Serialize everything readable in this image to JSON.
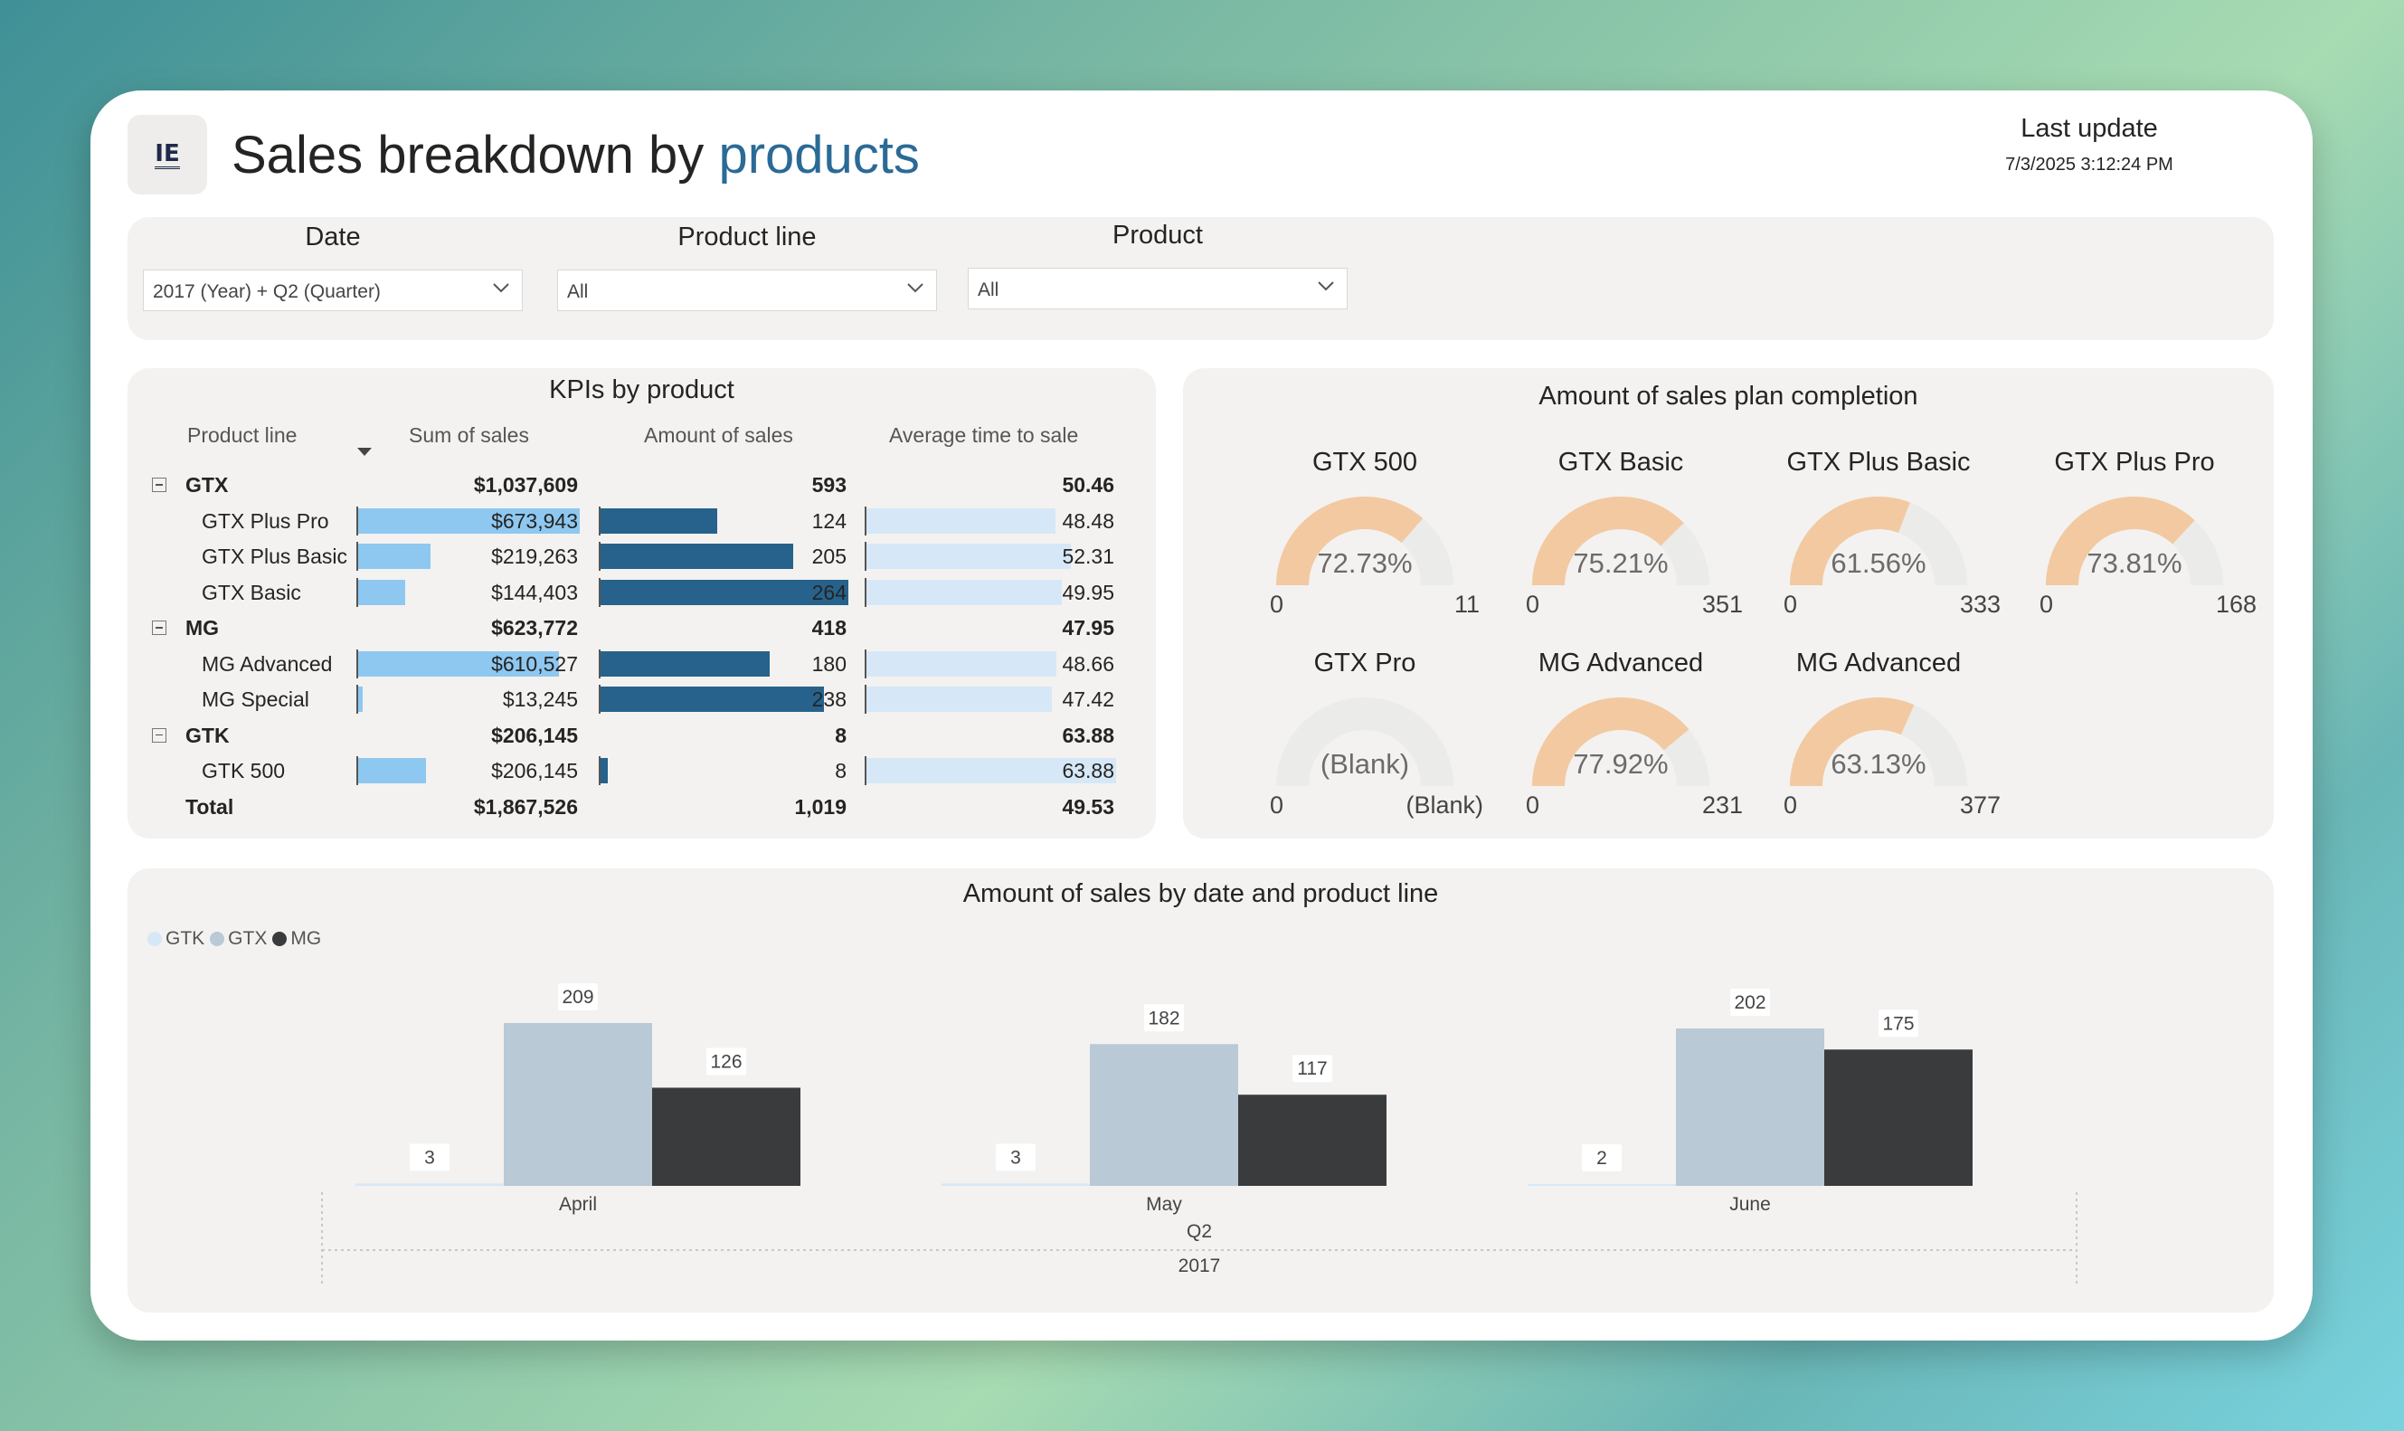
{
  "header": {
    "logo": "IE",
    "title_part1": "Sales breakdown by ",
    "title_part2": "products",
    "last_update_label": "Last update",
    "last_update_value": "7/3/2025 3:12:24 PM"
  },
  "filters": {
    "date": {
      "label": "Date",
      "value": "2017 (Year) + Q2 (Quarter)"
    },
    "product_line": {
      "label": "Product line",
      "value": "All"
    },
    "product": {
      "label": "Product",
      "value": "All"
    }
  },
  "kpi_table": {
    "title": "KPIs by product",
    "headers": [
      "Product line",
      "Sum of sales",
      "Amount of sales",
      "Average time to sale"
    ],
    "rows": [
      {
        "label": "GTX",
        "level": "group",
        "sum": "$1,037,609",
        "amount": "593",
        "avg": "50.46"
      },
      {
        "label": "GTX Plus Pro",
        "level": "item",
        "sum": "$673,943",
        "amount": "124",
        "avg": "48.48",
        "sum_v": 673943,
        "amt_v": 124,
        "avg_v": 48.48
      },
      {
        "label": "GTX Plus Basic",
        "level": "item",
        "sum": "$219,263",
        "amount": "205",
        "avg": "52.31",
        "sum_v": 219263,
        "amt_v": 205,
        "avg_v": 52.31
      },
      {
        "label": "GTX Basic",
        "level": "item",
        "sum": "$144,403",
        "amount": "264",
        "avg": "49.95",
        "sum_v": 144403,
        "amt_v": 264,
        "avg_v": 49.95
      },
      {
        "label": "MG",
        "level": "group",
        "sum": "$623,772",
        "amount": "418",
        "avg": "47.95"
      },
      {
        "label": "MG Advanced",
        "level": "item",
        "sum": "$610,527",
        "amount": "180",
        "avg": "48.66",
        "sum_v": 610527,
        "amt_v": 180,
        "avg_v": 48.66
      },
      {
        "label": "MG Special",
        "level": "item",
        "sum": "$13,245",
        "amount": "238",
        "avg": "47.42",
        "sum_v": 13245,
        "amt_v": 238,
        "avg_v": 47.42
      },
      {
        "label": "GTK",
        "level": "group",
        "sum": "$206,145",
        "amount": "8",
        "avg": "63.88"
      },
      {
        "label": "GTK 500",
        "level": "item",
        "sum": "$206,145",
        "amount": "8",
        "avg": "63.88",
        "sum_v": 206145,
        "amt_v": 8,
        "avg_v": 63.88
      },
      {
        "label": "Total",
        "level": "total",
        "sum": "$1,867,526",
        "amount": "1,019",
        "avg": "49.53"
      }
    ],
    "colors": {
      "sum_bar": "#8ec8f0",
      "amount_bar": "#26628c",
      "avg_bar": "#d6e8f7"
    }
  },
  "gauges": {
    "title": "Amount of sales plan completion",
    "items": [
      {
        "name": "GTX 500",
        "pct": "72.73%",
        "value": 0.7273,
        "min": "0",
        "max": "11"
      },
      {
        "name": "GTX Basic",
        "pct": "75.21%",
        "value": 0.7521,
        "min": "0",
        "max": "351"
      },
      {
        "name": "GTX Plus Basic",
        "pct": "61.56%",
        "value": 0.6156,
        "min": "0",
        "max": "333"
      },
      {
        "name": "GTX Plus Pro",
        "pct": "73.81%",
        "value": 0.7381,
        "min": "0",
        "max": "168"
      },
      {
        "name": "GTX Pro",
        "pct": "(Blank)",
        "value": 0,
        "min": "0",
        "max": "(Blank)"
      },
      {
        "name": "MG Advanced",
        "pct": "77.92%",
        "value": 0.7792,
        "min": "0",
        "max": "231"
      },
      {
        "name": "MG Advanced",
        "pct": "63.13%",
        "value": 0.6313,
        "min": "0",
        "max": "377"
      }
    ],
    "colors": {
      "fill": "#f2c9a1",
      "track": "#ebebea"
    }
  },
  "chart_data": {
    "type": "bar",
    "title": "Amount of sales by date and product line",
    "categories": [
      "April",
      "May",
      "June"
    ],
    "quarter_label": "Q2",
    "year_label": "2017",
    "series": [
      {
        "name": "GTK",
        "values": [
          3,
          3,
          2
        ],
        "color": "#d6e8f7"
      },
      {
        "name": "GTX",
        "values": [
          209,
          182,
          202
        ],
        "color": "#b9c9d6"
      },
      {
        "name": "MG",
        "values": [
          126,
          117,
          175
        ],
        "color": "#3a3b3d"
      }
    ],
    "ylim": [
      0,
      209
    ],
    "legend_position": "top-left"
  }
}
